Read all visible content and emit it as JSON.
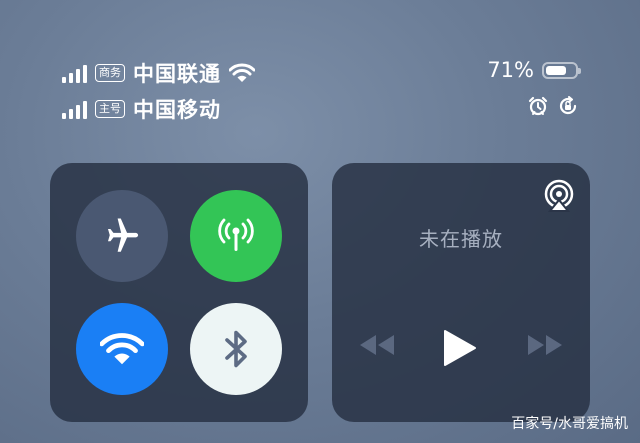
{
  "status_bar": {
    "sim1": {
      "tag": "商务",
      "carrier": "中国联通"
    },
    "sim2": {
      "tag": "主号",
      "carrier": "中国移动"
    },
    "battery": {
      "percent_text": "71%",
      "level": 0.71
    },
    "icons": [
      "wifi-icon",
      "alarm-icon",
      "rotation-lock-icon"
    ]
  },
  "connectivity": {
    "airplane": {
      "icon": "airplane-icon",
      "state": "off",
      "color": "#4a5872"
    },
    "cellular": {
      "icon": "antenna-icon",
      "state": "on",
      "color": "#33c556"
    },
    "wifi": {
      "icon": "wifi-icon",
      "state": "on",
      "color": "#1a7ff5"
    },
    "bluetooth": {
      "icon": "bluetooth-icon",
      "state": "on",
      "color": "#edf5f5"
    }
  },
  "media": {
    "status_text": "未在播放",
    "icons": [
      "airplay-icon",
      "rewind-icon",
      "play-icon",
      "fast-forward-icon"
    ]
  },
  "watermark": "百家号/水哥爱搞机"
}
